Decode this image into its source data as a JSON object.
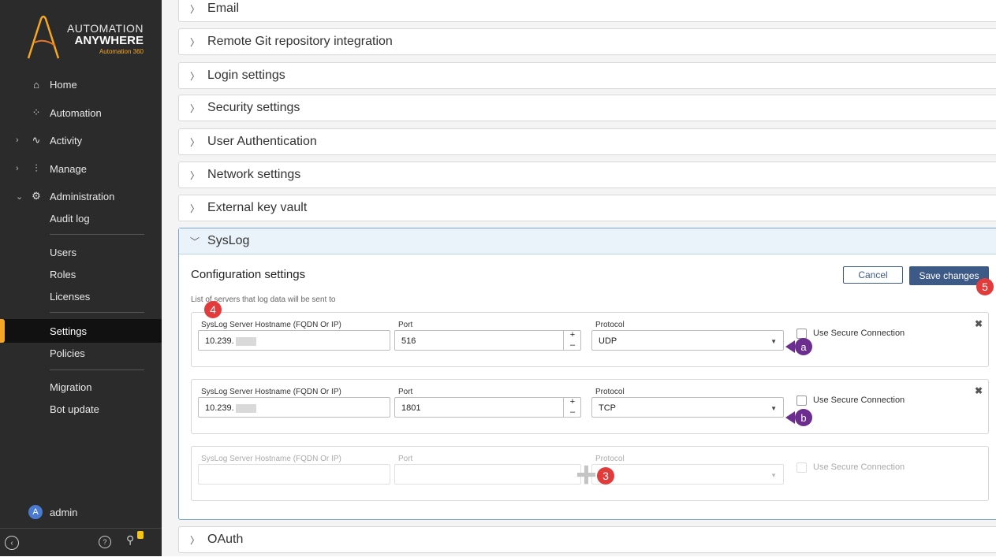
{
  "sidebar": {
    "logo": {
      "line1": "AUTOMATION",
      "line2": "ANYWHERE",
      "line3": "Automation 360"
    },
    "nav": [
      {
        "label": "Home",
        "icon": "home-icon"
      },
      {
        "label": "Automation",
        "icon": "automation-icon"
      },
      {
        "label": "Activity",
        "icon": "activity-icon"
      },
      {
        "label": "Manage",
        "icon": "manage-icon"
      },
      {
        "label": "Administration",
        "icon": "gear-icon"
      }
    ],
    "admin_items": [
      "Audit log",
      "Users",
      "Roles",
      "Licenses",
      "Settings",
      "Policies",
      "Migration",
      "Bot update"
    ],
    "active_item": "Settings",
    "user": {
      "initial": "A",
      "name": "admin"
    }
  },
  "sections": {
    "email": "Email",
    "git": "Remote Git repository integration",
    "login": "Login settings",
    "security": "Security settings",
    "user_auth": "User Authentication",
    "network": "Network settings",
    "key_vault": "External key vault",
    "syslog": "SysLog",
    "oauth": "OAuth"
  },
  "syslog": {
    "config_title": "Configuration settings",
    "subtitle": "List of servers that log data will be sent to",
    "cancel_label": "Cancel",
    "save_label": "Save changes",
    "hostname_label": "SysLog Server Hostname (FQDN Or IP)",
    "port_label": "Port",
    "protocol_label": "Protocol",
    "secure_label": "Use Secure Connection",
    "servers": [
      {
        "hostname": "10.239.",
        "port": "516",
        "protocol": "UDP",
        "secure": false
      },
      {
        "hostname": "10.239.",
        "port": "1801",
        "protocol": "TCP",
        "secure": false
      }
    ]
  },
  "annotations": {
    "callout_3": "3",
    "callout_4": "4",
    "callout_5": "5",
    "marker_a": "a",
    "marker_b": "b"
  },
  "colors": {
    "sidebar_bg": "#2b2b2b",
    "accent_orange": "#f5a623",
    "primary_button": "#3d5a87",
    "callout_red": "#e23b3b",
    "marker_purple": "#6b2e8e"
  }
}
